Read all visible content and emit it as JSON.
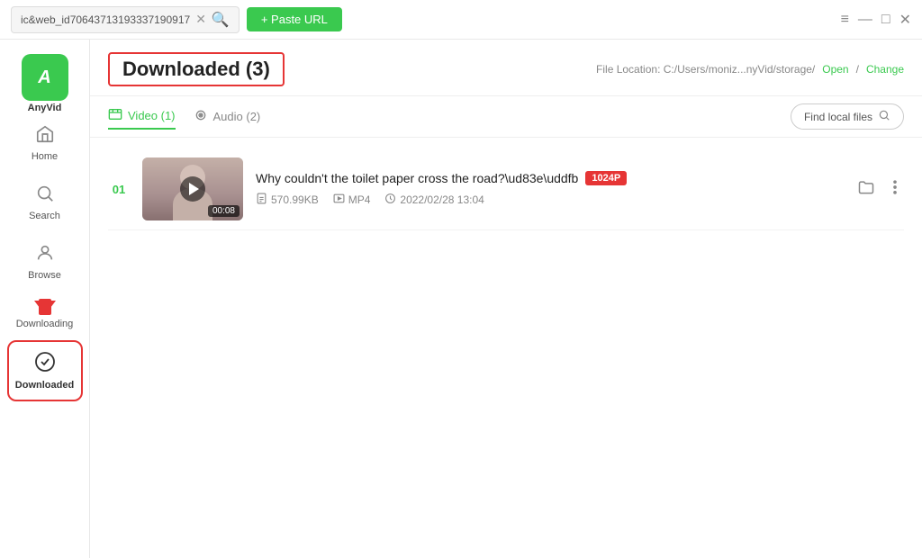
{
  "titleBar": {
    "urlText": "ic&web_id70643713193337190917",
    "pasteUrlLabel": "+ Paste URL",
    "controls": [
      "≡",
      "—",
      "□",
      "✕"
    ]
  },
  "sidebar": {
    "logoText": "A",
    "logoLabel": "AnyVid",
    "navItems": [
      {
        "id": "home",
        "icon": "🏠",
        "label": "Home",
        "active": false
      },
      {
        "id": "search",
        "icon": "🔍",
        "label": "Search",
        "active": false
      },
      {
        "id": "browse",
        "icon": "👤",
        "label": "Browse",
        "active": false
      },
      {
        "id": "downloading",
        "icon": "⬇",
        "label": "Downloading",
        "active": false
      },
      {
        "id": "downloaded",
        "icon": "✔",
        "label": "Downloaded",
        "active": true
      }
    ]
  },
  "content": {
    "pageTitle": "Downloaded (3)",
    "fileLocation": {
      "label": "File Location: C:/Users/moniz...nyVid/storage/",
      "openLabel": "Open",
      "changeLabel": "Change"
    },
    "tabs": [
      {
        "id": "video",
        "icon": "📋",
        "label": "Video (1)",
        "active": true
      },
      {
        "id": "audio",
        "icon": "🎵",
        "label": "Audio (2)",
        "active": false
      }
    ],
    "findLocalLabel": "Find local files",
    "videos": [
      {
        "num": "01",
        "title": "Why couldn't the toilet paper cross the road?\\ud83e\\uddfb",
        "quality": "1024P",
        "fileSize": "570.99KB",
        "format": "MP4",
        "date": "2022/02/28 13:04",
        "duration": "00:08"
      }
    ]
  }
}
